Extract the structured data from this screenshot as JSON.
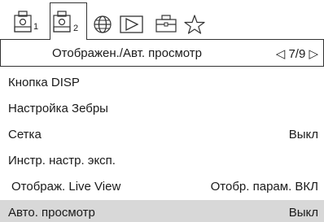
{
  "tabs": [
    {
      "icon": "camera-icon",
      "number": "1",
      "active": false
    },
    {
      "icon": "camera-icon",
      "number": "2",
      "active": true
    },
    {
      "icon": "globe-icon",
      "number": "",
      "active": false
    },
    {
      "icon": "playback-icon",
      "number": "",
      "active": false
    },
    {
      "icon": "toolbox-icon",
      "number": "",
      "active": false
    },
    {
      "icon": "star-icon",
      "number": "",
      "active": false
    }
  ],
  "header": {
    "title": "Отображен./Авт. просмотр",
    "page": "◁ 7/9 ▷"
  },
  "menu": {
    "items": [
      {
        "label": "Кнопка DISP",
        "value": ""
      },
      {
        "label": "Настройка Зебры",
        "value": ""
      },
      {
        "label": "Сетка",
        "value": "Выкл"
      },
      {
        "label": "Инстр. настр. эксп.",
        "value": ""
      },
      {
        "label": "Отображ. Live View",
        "value": "Отобр. парам. ВКЛ"
      },
      {
        "label": "Авто. просмотр",
        "value": "Выкл"
      }
    ]
  }
}
